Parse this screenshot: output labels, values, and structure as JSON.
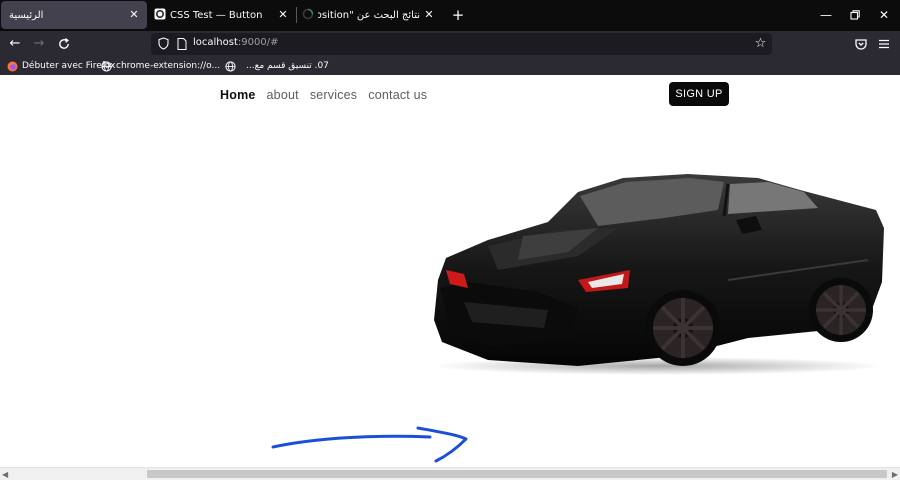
{
  "browser": {
    "tabs": [
      {
        "title": "الرئيسية",
        "active": true
      },
      {
        "title": "CSS Test — Button",
        "active": false
      },
      {
        "title": "نتائج البحث عن \"object-position\"",
        "active": false
      }
    ],
    "address": {
      "host": "localhost",
      "rest": ":9000/#"
    },
    "bookmarks": [
      {
        "label": "Débuter avec Firefox",
        "icon": "firefox-icon"
      },
      {
        "label": "chrome-extension://o...",
        "icon": "globe-icon"
      },
      {
        "label": "07. تنسيق قسم مع...",
        "icon": "globe-icon"
      }
    ]
  },
  "site": {
    "nav": [
      {
        "label": "Home",
        "active": true
      },
      {
        "label": "about",
        "active": false
      },
      {
        "label": "services",
        "active": false
      },
      {
        "label": "contact us",
        "active": false
      }
    ],
    "signup_label": "SIGN UP",
    "hero_image": "black-sports-car"
  },
  "annotation": {
    "color": "#1a4fd6",
    "shape": "hand-drawn-arrow"
  },
  "scrollbar": {
    "thumb_start": 0.163,
    "thumb_size": 0.822
  }
}
